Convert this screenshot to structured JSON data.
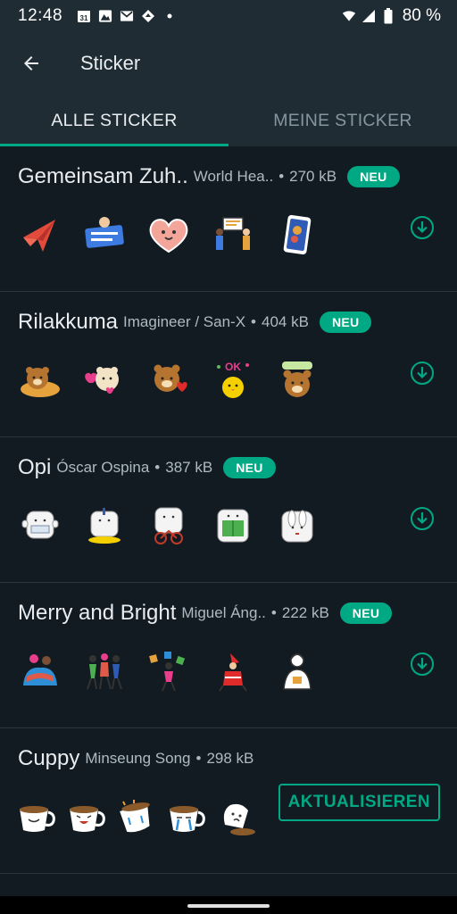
{
  "status": {
    "time": "12:48",
    "battery": "80 %",
    "calendar_day": "31"
  },
  "header": {
    "title": "Sticker"
  },
  "tabs": [
    {
      "label": "ALLE STICKER",
      "active": true
    },
    {
      "label": "MEINE STICKER",
      "active": false
    }
  ],
  "colors": {
    "accent": "#00a884",
    "background": "#121b22",
    "bar": "#1f2c34"
  },
  "packs": [
    {
      "name": "Gemeinsam Zuh..",
      "author": "World Hea..",
      "size": "270 kB",
      "badge": "NEU",
      "stickers": [
        "paper-plane-heart",
        "shout-banner",
        "smiling-heart",
        "high-five-people",
        "phone-selfie"
      ]
    },
    {
      "name": "Rilakkuma",
      "author": "Imagineer / San-X",
      "size": "404 kB",
      "badge": "NEU",
      "stickers": [
        "bear-lying",
        "bear-hearts",
        "bear-heart",
        "chick-ok",
        "bear-thanks"
      ]
    },
    {
      "name": "Opi",
      "author": "Óscar Ospina",
      "size": "387 kB",
      "badge": "NEU",
      "stickers": [
        "opi-sign",
        "opi-hands-up",
        "opi-bike",
        "opi-reading",
        "opi-bunny-ears"
      ]
    },
    {
      "name": "Merry and Bright",
      "author": "Miguel Áng..",
      "size": "222 kB",
      "badge": "NEU",
      "stickers": [
        "couple-hug",
        "dancing-group",
        "party-juggler",
        "santa-dancer",
        "gift-girl"
      ]
    },
    {
      "name": "Cuppy",
      "author": "Minseung Song",
      "size": "298 kB",
      "action": "AKTUALISIEREN",
      "stickers": [
        "cup-happy",
        "cup-laugh",
        "cup-crying",
        "cup-tears",
        "cup-spill"
      ]
    }
  ]
}
